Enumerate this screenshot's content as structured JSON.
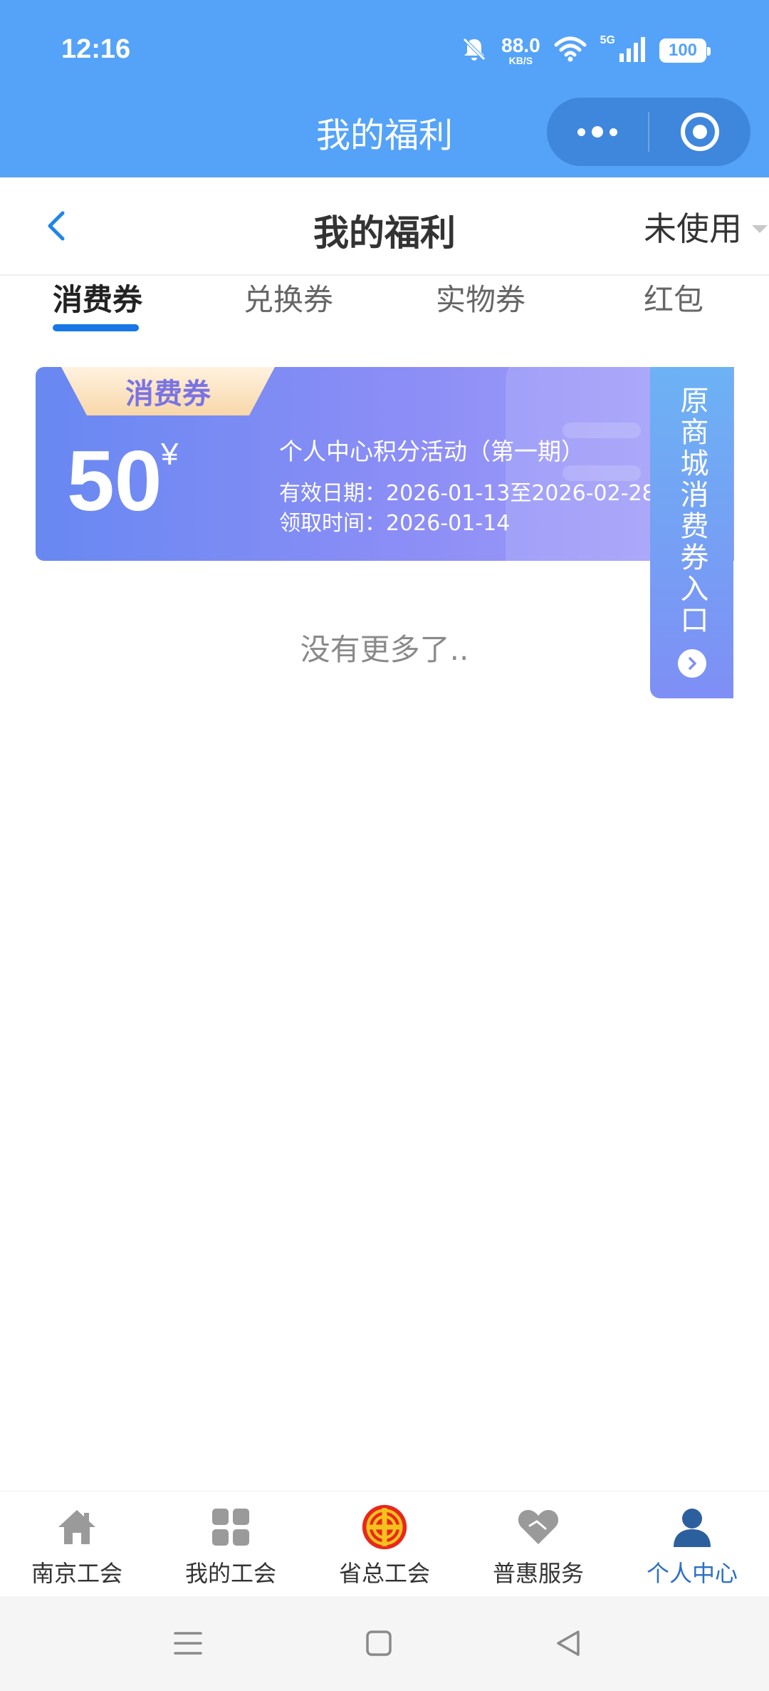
{
  "status_bar": {
    "time": "12:16",
    "net_speed_value": "88.0",
    "net_speed_unit": "KB/S",
    "network": "5G",
    "battery": "100",
    "icons": [
      "bell-off-icon",
      "wifi-icon",
      "signal-icon",
      "battery-icon"
    ]
  },
  "mini_program": {
    "title": "我的福利",
    "capsule": {
      "more_icon": "more-dots-icon",
      "close_icon": "target-close-icon"
    }
  },
  "navbar": {
    "title": "我的福利",
    "filter_label": "未使用"
  },
  "tabs": [
    {
      "label": "消费券",
      "active": true
    },
    {
      "label": "兑换券",
      "active": false
    },
    {
      "label": "实物券",
      "active": false
    },
    {
      "label": "红包",
      "active": false
    }
  ],
  "coupon": {
    "badge": "消费券",
    "amount": "50",
    "currency": "¥",
    "title": "个人中心积分活动（第一期）",
    "validity_label": "有效日期：",
    "validity_value": "2026-01-13至2026-02-28",
    "received_label": "领取时间：",
    "received_value": "2026-01-14"
  },
  "side_entry": {
    "label": "原商城消费券入口"
  },
  "list_end_text": "没有更多了..",
  "tabbar": [
    {
      "label": "南京工会",
      "icon": "home-icon",
      "active": false
    },
    {
      "label": "我的工会",
      "icon": "grid-icon",
      "active": false
    },
    {
      "label": "省总工会",
      "icon": "union-emblem-icon",
      "active": false
    },
    {
      "label": "普惠服务",
      "icon": "heart-hands-icon",
      "active": false
    },
    {
      "label": "个人中心",
      "icon": "person-icon",
      "active": true
    }
  ],
  "colors": {
    "topbar": "#55a3f8",
    "accent": "#1778e6",
    "tab_active_label": "#2c70c4",
    "coupon_start": "#6888f2",
    "coupon_end": "#a6a0fb",
    "emblem_red": "#e8281c",
    "emblem_yellow": "#f4c21c"
  }
}
